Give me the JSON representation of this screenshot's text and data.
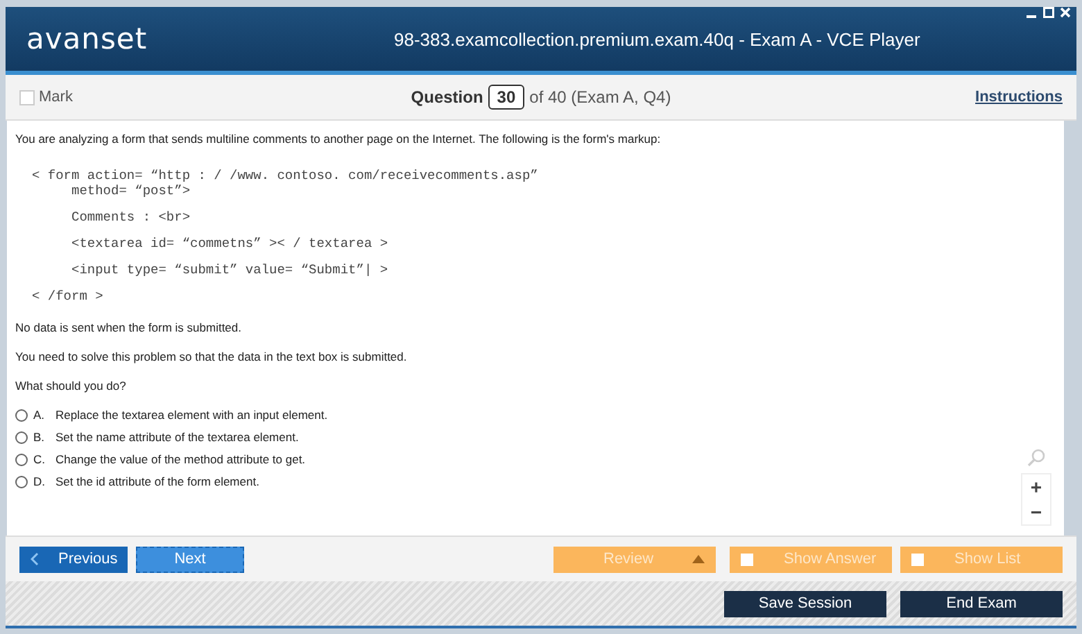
{
  "window": {
    "logo": "avanset",
    "title": "98-383.examcollection.premium.exam.40q - Exam A - VCE Player"
  },
  "toolbar": {
    "mark": {
      "label": "Mark",
      "checked": false
    },
    "question_label": "Question",
    "question_number": "30",
    "question_of": "of 40 (Exam A, Q4)",
    "instructions": "Instructions"
  },
  "question": {
    "intro": "You are analyzing a form that sends multiline comments to another page on the Internet. The following is the form's markup:",
    "code_lines": [
      "< form action= “http : / /www. contoso. com/receivecomments.asp”",
      "     method= “post”>",
      "     Comments : <br>",
      "     <textarea id= “commetns” >< / textarea >",
      "     <input type= “submit” value= “Submit”| >",
      "< /form >"
    ],
    "paragraphs": [
      "No data is sent when the form is submitted.",
      "You need to solve this problem so that the data in the text box is submitted.",
      "What should you do?"
    ],
    "options": [
      {
        "letter": "A.",
        "text": "Replace the textarea element with an input element.",
        "selected": false
      },
      {
        "letter": "B.",
        "text": "Set the name attribute of the textarea element.",
        "selected": false
      },
      {
        "letter": "C.",
        "text": "Change the value of the method attribute to get.",
        "selected": false
      },
      {
        "letter": "D.",
        "text": "Set the id attribute of the form element.",
        "selected": false
      }
    ]
  },
  "zoom": {
    "plus": "+",
    "minus": "−"
  },
  "nav": {
    "previous": "Previous",
    "next": "Next",
    "review": "Review",
    "show_answer": {
      "label": "Show Answer",
      "checked": false
    },
    "show_list": {
      "label": "Show List",
      "checked": false
    }
  },
  "footer": {
    "save": "Save Session",
    "end": "End Exam"
  }
}
